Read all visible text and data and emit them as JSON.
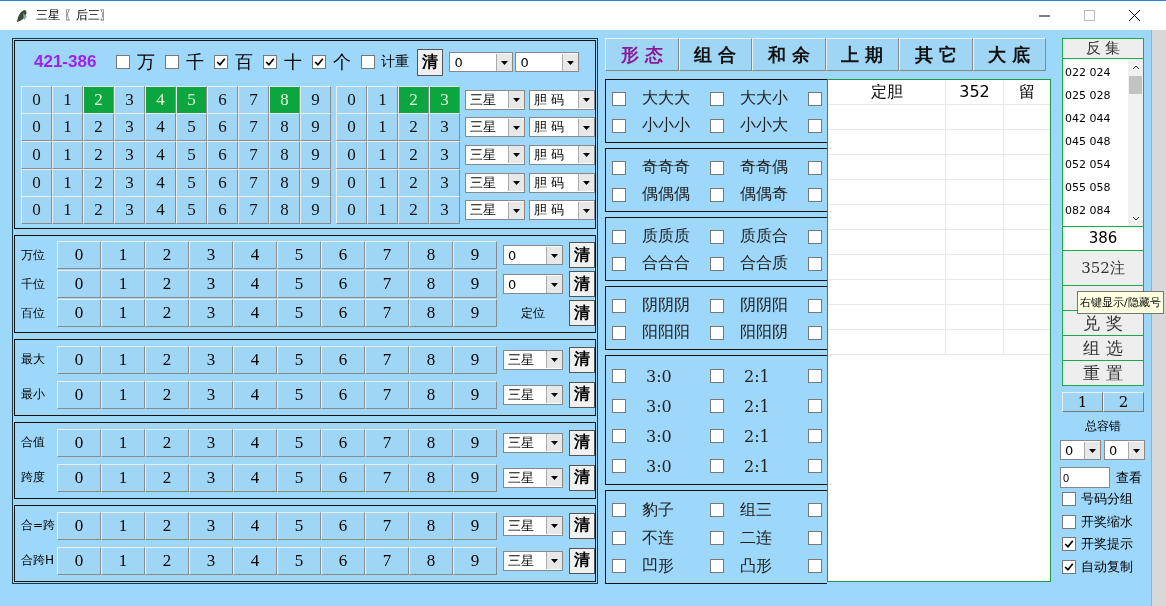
{
  "window": {
    "title": "三星 〖后三〗"
  },
  "top": {
    "code": "421-386",
    "positions": [
      {
        "label": "万",
        "checked": false
      },
      {
        "label": "千",
        "checked": false
      },
      {
        "label": "百",
        "checked": true
      },
      {
        "label": "十",
        "checked": true
      },
      {
        "label": "个",
        "checked": true
      }
    ],
    "repeat": {
      "label": "计重",
      "checked": false
    },
    "clear": "清",
    "selects": [
      "0",
      "0"
    ]
  },
  "grid_rows": [
    {
      "digits": [
        {
          "label": "0",
          "selected": false
        },
        {
          "label": "1",
          "selected": false
        },
        {
          "label": "2",
          "selected": true
        },
        {
          "label": "3",
          "selected": false
        },
        {
          "label": "4",
          "selected": true
        },
        {
          "label": "5",
          "selected": true
        },
        {
          "label": "6",
          "selected": false
        },
        {
          "label": "7",
          "selected": false
        },
        {
          "label": "8",
          "selected": true
        },
        {
          "label": "9",
          "selected": false
        }
      ],
      "extra": [
        {
          "label": "0",
          "selected": false
        },
        {
          "label": "1",
          "selected": false
        },
        {
          "label": "2",
          "selected": true
        },
        {
          "label": "3",
          "selected": true
        }
      ],
      "selects": [
        "三星",
        "胆 码"
      ]
    },
    {
      "digits": [
        {
          "label": "0",
          "selected": false
        },
        {
          "label": "1",
          "selected": false
        },
        {
          "label": "2",
          "selected": false
        },
        {
          "label": "3",
          "selected": false
        },
        {
          "label": "4",
          "selected": false
        },
        {
          "label": "5",
          "selected": false
        },
        {
          "label": "6",
          "selected": false
        },
        {
          "label": "7",
          "selected": false
        },
        {
          "label": "8",
          "selected": false
        },
        {
          "label": "9",
          "selected": false
        }
      ],
      "extra": [
        {
          "label": "0",
          "selected": false
        },
        {
          "label": "1",
          "selected": false
        },
        {
          "label": "2",
          "selected": false
        },
        {
          "label": "3",
          "selected": false
        }
      ],
      "selects": [
        "三星",
        "胆 码"
      ]
    },
    {
      "digits": [
        {
          "label": "0",
          "selected": false
        },
        {
          "label": "1",
          "selected": false
        },
        {
          "label": "2",
          "selected": false
        },
        {
          "label": "3",
          "selected": false
        },
        {
          "label": "4",
          "selected": false
        },
        {
          "label": "5",
          "selected": false
        },
        {
          "label": "6",
          "selected": false
        },
        {
          "label": "7",
          "selected": false
        },
        {
          "label": "8",
          "selected": false
        },
        {
          "label": "9",
          "selected": false
        }
      ],
      "extra": [
        {
          "label": "0",
          "selected": false
        },
        {
          "label": "1",
          "selected": false
        },
        {
          "label": "2",
          "selected": false
        },
        {
          "label": "3",
          "selected": false
        }
      ],
      "selects": [
        "三星",
        "胆 码"
      ]
    },
    {
      "digits": [
        {
          "label": "0",
          "selected": false
        },
        {
          "label": "1",
          "selected": false
        },
        {
          "label": "2",
          "selected": false
        },
        {
          "label": "3",
          "selected": false
        },
        {
          "label": "4",
          "selected": false
        },
        {
          "label": "5",
          "selected": false
        },
        {
          "label": "6",
          "selected": false
        },
        {
          "label": "7",
          "selected": false
        },
        {
          "label": "8",
          "selected": false
        },
        {
          "label": "9",
          "selected": false
        }
      ],
      "extra": [
        {
          "label": "0",
          "selected": false
        },
        {
          "label": "1",
          "selected": false
        },
        {
          "label": "2",
          "selected": false
        },
        {
          "label": "3",
          "selected": false
        }
      ],
      "selects": [
        "三星",
        "胆 码"
      ]
    },
    {
      "digits": [
        {
          "label": "0",
          "selected": false
        },
        {
          "label": "1",
          "selected": false
        },
        {
          "label": "2",
          "selected": false
        },
        {
          "label": "3",
          "selected": false
        },
        {
          "label": "4",
          "selected": false
        },
        {
          "label": "5",
          "selected": false
        },
        {
          "label": "6",
          "selected": false
        },
        {
          "label": "7",
          "selected": false
        },
        {
          "label": "8",
          "selected": false
        },
        {
          "label": "9",
          "selected": false
        }
      ],
      "extra": [
        {
          "label": "0",
          "selected": false
        },
        {
          "label": "1",
          "selected": false
        },
        {
          "label": "2",
          "selected": false
        },
        {
          "label": "3",
          "selected": false
        }
      ],
      "selects": [
        "三星",
        "胆 码"
      ]
    }
  ],
  "groups": [
    {
      "rows": [
        {
          "label": "万位",
          "digits": [
            {
              "label": "0",
              "selected": false
            },
            {
              "label": "1",
              "selected": false
            },
            {
              "label": "2",
              "selected": false
            },
            {
              "label": "3",
              "selected": false
            },
            {
              "label": "4",
              "selected": false
            },
            {
              "label": "5",
              "selected": false
            },
            {
              "label": "6",
              "selected": false
            },
            {
              "label": "7",
              "selected": false
            },
            {
              "label": "8",
              "selected": false
            },
            {
              "label": "9",
              "selected": false
            }
          ],
          "select": "0",
          "clear": "清"
        },
        {
          "label": "千位",
          "digits": [
            {
              "label": "0",
              "selected": false
            },
            {
              "label": "1",
              "selected": false
            },
            {
              "label": "2",
              "selected": false
            },
            {
              "label": "3",
              "selected": false
            },
            {
              "label": "4",
              "selected": false
            },
            {
              "label": "5",
              "selected": false
            },
            {
              "label": "6",
              "selected": false
            },
            {
              "label": "7",
              "selected": false
            },
            {
              "label": "8",
              "selected": false
            },
            {
              "label": "9",
              "selected": false
            }
          ],
          "select": "0",
          "clear": "清"
        },
        {
          "label": "百位",
          "digits": [
            {
              "label": "0",
              "selected": false
            },
            {
              "label": "1",
              "selected": false
            },
            {
              "label": "2",
              "selected": false
            },
            {
              "label": "3",
              "selected": false
            },
            {
              "label": "4",
              "selected": false
            },
            {
              "label": "5",
              "selected": false
            },
            {
              "label": "6",
              "selected": false
            },
            {
              "label": "7",
              "selected": false
            },
            {
              "label": "8",
              "selected": false
            },
            {
              "label": "9",
              "selected": false
            }
          ],
          "note": "定位",
          "clear": "清"
        }
      ]
    },
    {
      "rows": [
        {
          "label": "最大",
          "digits": [
            {
              "label": "0",
              "selected": false
            },
            {
              "label": "1",
              "selected": false
            },
            {
              "label": "2",
              "selected": false
            },
            {
              "label": "3",
              "selected": false
            },
            {
              "label": "4",
              "selected": false
            },
            {
              "label": "5",
              "selected": false
            },
            {
              "label": "6",
              "selected": false
            },
            {
              "label": "7",
              "selected": false
            },
            {
              "label": "8",
              "selected": false
            },
            {
              "label": "9",
              "selected": false
            }
          ],
          "select": "三星",
          "clear": "清"
        },
        {
          "label": "最小",
          "digits": [
            {
              "label": "0",
              "selected": false
            },
            {
              "label": "1",
              "selected": false
            },
            {
              "label": "2",
              "selected": false
            },
            {
              "label": "3",
              "selected": false
            },
            {
              "label": "4",
              "selected": false
            },
            {
              "label": "5",
              "selected": false
            },
            {
              "label": "6",
              "selected": false
            },
            {
              "label": "7",
              "selected": false
            },
            {
              "label": "8",
              "selected": false
            },
            {
              "label": "9",
              "selected": false
            }
          ],
          "select": "三星",
          "clear": "清"
        }
      ]
    },
    {
      "rows": [
        {
          "label": "合值",
          "digits": [
            {
              "label": "0",
              "selected": false
            },
            {
              "label": "1",
              "selected": false
            },
            {
              "label": "2",
              "selected": false
            },
            {
              "label": "3",
              "selected": false
            },
            {
              "label": "4",
              "selected": false
            },
            {
              "label": "5",
              "selected": false
            },
            {
              "label": "6",
              "selected": false
            },
            {
              "label": "7",
              "selected": false
            },
            {
              "label": "8",
              "selected": false
            },
            {
              "label": "9",
              "selected": false
            }
          ],
          "select": "三星",
          "clear": "清"
        },
        {
          "label": "跨度",
          "digits": [
            {
              "label": "0",
              "selected": false
            },
            {
              "label": "1",
              "selected": false
            },
            {
              "label": "2",
              "selected": false
            },
            {
              "label": "3",
              "selected": false
            },
            {
              "label": "4",
              "selected": false
            },
            {
              "label": "5",
              "selected": false
            },
            {
              "label": "6",
              "selected": false
            },
            {
              "label": "7",
              "selected": false
            },
            {
              "label": "8",
              "selected": false
            },
            {
              "label": "9",
              "selected": false
            }
          ],
          "select": "三星",
          "clear": "清"
        }
      ]
    },
    {
      "rows": [
        {
          "label": "合=跨",
          "digits": [
            {
              "label": "0",
              "selected": false
            },
            {
              "label": "1",
              "selected": false
            },
            {
              "label": "2",
              "selected": false
            },
            {
              "label": "3",
              "selected": false
            },
            {
              "label": "4",
              "selected": false
            },
            {
              "label": "5",
              "selected": false
            },
            {
              "label": "6",
              "selected": false
            },
            {
              "label": "7",
              "selected": false
            },
            {
              "label": "8",
              "selected": false
            },
            {
              "label": "9",
              "selected": false
            }
          ],
          "select": "三星",
          "clear": "清"
        },
        {
          "label": "合跨H",
          "digits": [
            {
              "label": "0",
              "selected": false
            },
            {
              "label": "1",
              "selected": false
            },
            {
              "label": "2",
              "selected": false
            },
            {
              "label": "3",
              "selected": false
            },
            {
              "label": "4",
              "selected": false
            },
            {
              "label": "5",
              "selected": false
            },
            {
              "label": "6",
              "selected": false
            },
            {
              "label": "7",
              "selected": false
            },
            {
              "label": "8",
              "selected": false
            },
            {
              "label": "9",
              "selected": false
            }
          ],
          "select": "三星",
          "clear": "清"
        }
      ]
    }
  ],
  "tabs": [
    {
      "label": "形 态",
      "selected": true
    },
    {
      "label": "组 合",
      "selected": false
    },
    {
      "label": "和 余",
      "selected": false
    },
    {
      "label": "上 期",
      "selected": false
    },
    {
      "label": "其 它",
      "selected": false
    },
    {
      "label": "大 底",
      "selected": false
    }
  ],
  "option_groups": [
    {
      "rows": [
        {
          "items": [
            {
              "label": "大大大",
              "checked": false
            },
            {
              "label": "大大小",
              "checked": false
            }
          ],
          "tail": {
            "checked": false
          }
        },
        {
          "items": [
            {
              "label": "小小小",
              "checked": false
            },
            {
              "label": "小小大",
              "checked": false
            }
          ],
          "tail": {
            "checked": false
          }
        }
      ]
    },
    {
      "rows": [
        {
          "items": [
            {
              "label": "奇奇奇",
              "checked": false
            },
            {
              "label": "奇奇偶",
              "checked": false
            }
          ],
          "tail": {
            "checked": false
          }
        },
        {
          "items": [
            {
              "label": "偶偶偶",
              "checked": false
            },
            {
              "label": "偶偶奇",
              "checked": false
            }
          ],
          "tail": {
            "checked": false
          }
        }
      ]
    },
    {
      "rows": [
        {
          "items": [
            {
              "label": "质质质",
              "checked": false
            },
            {
              "label": "质质合",
              "checked": false
            }
          ],
          "tail": {
            "checked": false
          }
        },
        {
          "items": [
            {
              "label": "合合合",
              "checked": false
            },
            {
              "label": "合合质",
              "checked": false
            }
          ],
          "tail": {
            "checked": false
          }
        }
      ]
    },
    {
      "rows": [
        {
          "items": [
            {
              "label": "阴阴阴",
              "checked": false
            },
            {
              "label": "阴阴阳",
              "checked": false
            }
          ],
          "tail": {
            "checked": false
          }
        },
        {
          "items": [
            {
              "label": "阳阳阳",
              "checked": false
            },
            {
              "label": "阳阳阴",
              "checked": false
            }
          ],
          "tail": {
            "checked": false
          }
        }
      ]
    },
    {
      "rows": [
        {
          "items": [
            {
              "label": "3:0",
              "checked": false
            },
            {
              "label": "2:1",
              "checked": false
            }
          ],
          "tail": {
            "checked": false
          }
        },
        {
          "items": [
            {
              "label": "3:0",
              "checked": false
            },
            {
              "label": "2:1",
              "checked": false
            }
          ],
          "tail": {
            "checked": false
          }
        },
        {
          "items": [
            {
              "label": "3:0",
              "checked": false
            },
            {
              "label": "2:1",
              "checked": false
            }
          ],
          "tail": {
            "checked": false
          }
        },
        {
          "items": [
            {
              "label": "3:0",
              "checked": false
            },
            {
              "label": "2:1",
              "checked": false
            }
          ],
          "tail": {
            "checked": false
          }
        }
      ]
    },
    {
      "rows": [
        {
          "items": [
            {
              "label": "豹子",
              "checked": false
            },
            {
              "label": "组三",
              "checked": false
            }
          ],
          "tail": {
            "checked": false
          }
        },
        {
          "items": [
            {
              "label": "不连",
              "checked": false
            },
            {
              "label": "二连",
              "checked": false
            }
          ],
          "tail": {
            "checked": false
          }
        },
        {
          "items": [
            {
              "label": "凹形",
              "checked": false
            },
            {
              "label": "凸形",
              "checked": false
            }
          ],
          "tail": {
            "checked": false
          }
        }
      ]
    }
  ],
  "result_table": {
    "columns": [
      "定胆",
      "352",
      "留"
    ]
  },
  "right": {
    "header": "反 集",
    "list": [
      "022 024",
      "025 028",
      "042 044",
      "045 048",
      "052 054",
      "055 058",
      "082 084"
    ],
    "code": "386",
    "count": "352注",
    "buttons": [
      "兑 奖",
      "组 选",
      "重 置"
    ],
    "pages": [
      {
        "label": "1",
        "selected": false
      },
      {
        "label": "2",
        "selected": false
      }
    ],
    "tolerance_label": "总容错",
    "tolerance_selects": [
      "0",
      "0"
    ],
    "lookup": {
      "value": "0",
      "button": "查看"
    },
    "checks": [
      {
        "label": "号码分组",
        "checked": false
      },
      {
        "label": "开奖缩水",
        "checked": false
      },
      {
        "label": "开奖提示",
        "checked": true
      },
      {
        "label": "自动复制",
        "checked": true
      }
    ]
  },
  "tooltip": "右键显示/隐藏号"
}
